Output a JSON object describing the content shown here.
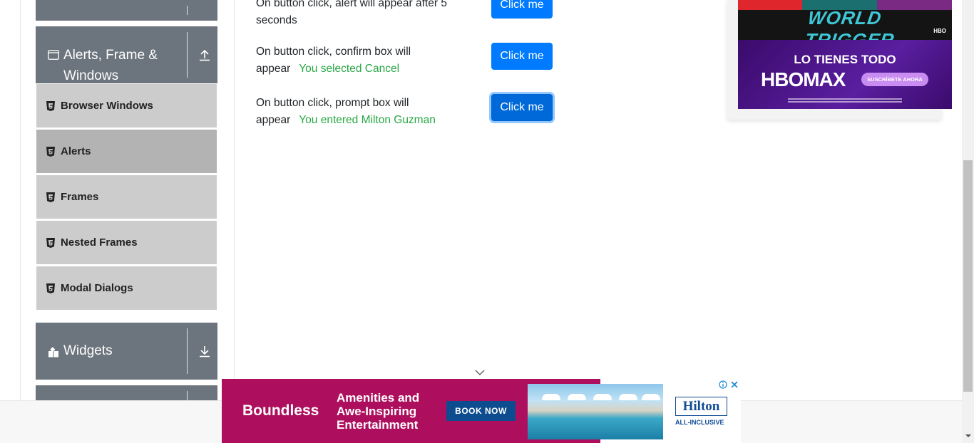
{
  "sidebar": {
    "groups": [
      {
        "label": "",
        "toggle_icon": "arrow-down-icon"
      },
      {
        "label": "Alerts, Frame & Windows",
        "lead_icon": "window-icon",
        "toggle_icon": "arrow-up-icon"
      },
      {
        "label": "Widgets",
        "lead_icon": "widgets-icon",
        "toggle_icon": "arrow-down-icon"
      },
      {
        "label": "",
        "toggle_icon": "arrow-down-icon"
      }
    ],
    "items": [
      {
        "label": "Browser Windows",
        "icon": "html5-icon",
        "active": false
      },
      {
        "label": "Alerts",
        "icon": "html5-icon",
        "active": true
      },
      {
        "label": "Frames",
        "icon": "html5-icon",
        "active": false
      },
      {
        "label": "Nested Frames",
        "icon": "html5-icon",
        "active": false
      },
      {
        "label": "Modal Dialogs",
        "icon": "html5-icon",
        "active": false
      }
    ]
  },
  "main": {
    "rows": [
      {
        "text": "On button click, alert will appear after 5 seconds",
        "result": "",
        "button": "Click me"
      },
      {
        "text": "On button click, confirm box will appear",
        "result": "You selected Cancel",
        "button": "Click me"
      },
      {
        "text": "On button click, prompt box will appear",
        "result": "You entered Milton Guzman",
        "button": "Click me"
      }
    ]
  },
  "ads": {
    "hbo": {
      "series": "WORLD TRIGGER",
      "network": "HBO",
      "tagline": "LO TIENES TODO",
      "brand": "HBOMAX",
      "cta": "SUSCRÍBETE AHORA"
    },
    "hilton": {
      "brand": "Boundless",
      "copy": "Amenities and Awe-Inspiring Entertainment",
      "cta": "BOOK NOW",
      "logo": "Hilton",
      "logo_sub": "ALL-INCLUSIVE"
    }
  },
  "colors": {
    "sidebar_header": "#6c757d",
    "menu_item": "#cccccc",
    "menu_item_active": "#b3b3b3",
    "button": "#007bff",
    "result_text": "#28a745",
    "hilton_magenta": "#ad0f5e",
    "hbo_purple": "#5a1ea0"
  }
}
